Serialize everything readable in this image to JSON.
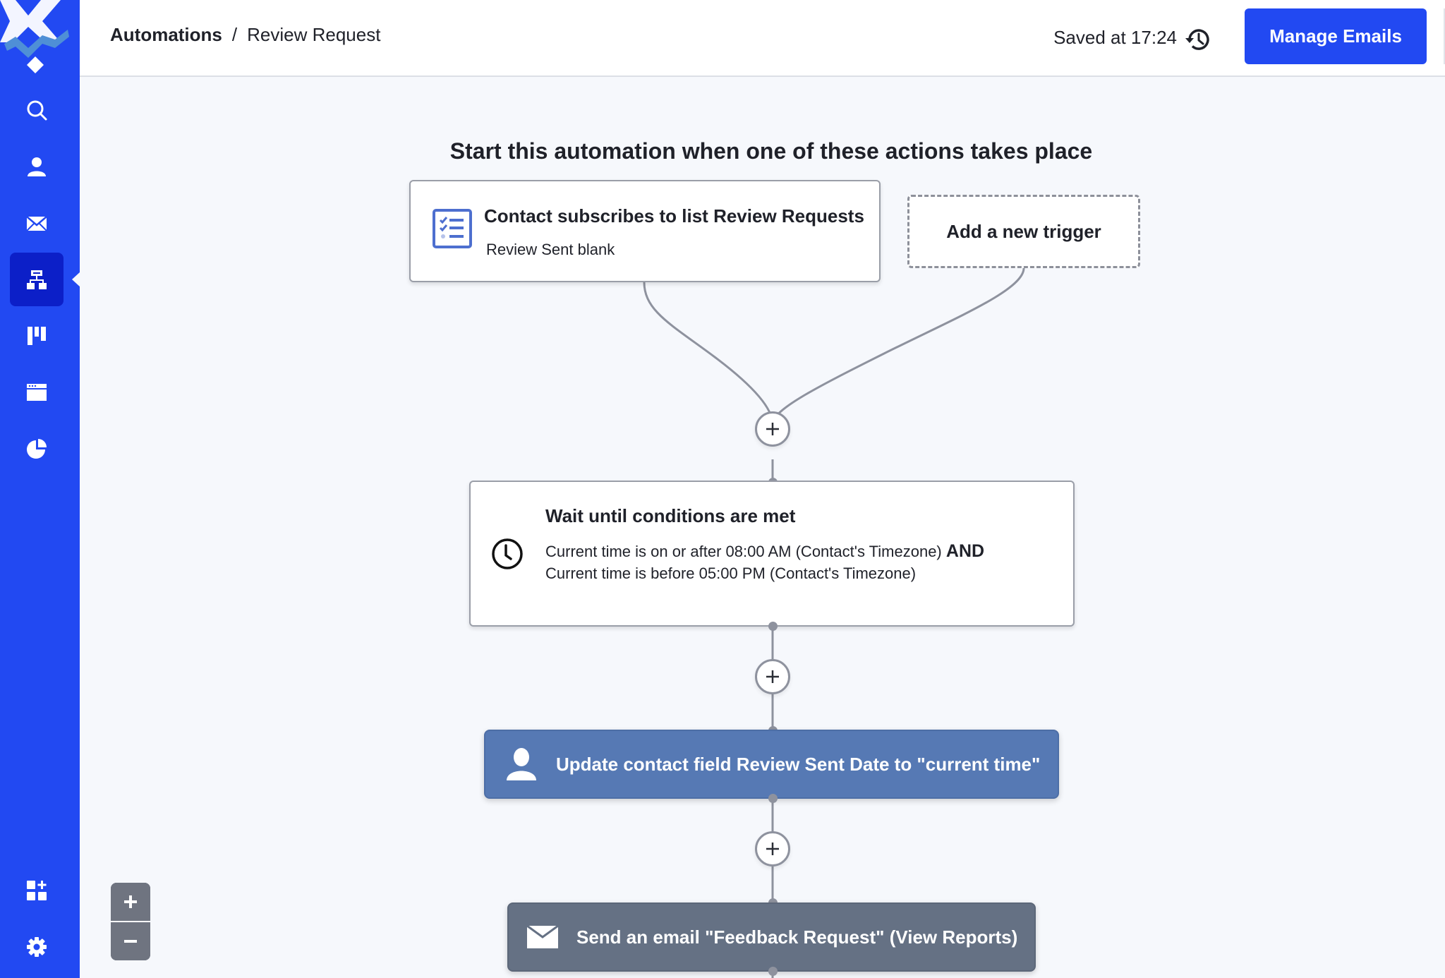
{
  "app": {
    "brand_color": "#2249f2",
    "active_nav_color": "#0c1fc8"
  },
  "sidebar": {
    "items": [
      {
        "id": "search",
        "icon": "search-icon",
        "label": "Search",
        "active": false
      },
      {
        "id": "contacts",
        "icon": "person-icon",
        "label": "Contacts",
        "active": false
      },
      {
        "id": "campaigns",
        "icon": "envelope-icon",
        "label": "Campaigns",
        "active": false
      },
      {
        "id": "automations",
        "icon": "org-chart-icon",
        "label": "Automations",
        "active": true
      },
      {
        "id": "deals",
        "icon": "pipeline-icon",
        "label": "Deals",
        "active": false
      },
      {
        "id": "website",
        "icon": "browser-window-icon",
        "label": "Website",
        "active": false
      },
      {
        "id": "reports",
        "icon": "pie-chart-icon",
        "label": "Reports",
        "active": false
      }
    ],
    "bottom_items": [
      {
        "id": "apps",
        "icon": "apps-add-icon",
        "label": "Apps"
      },
      {
        "id": "settings",
        "icon": "gear-icon",
        "label": "Settings"
      }
    ]
  },
  "header": {
    "breadcrumb": {
      "root": "Automations",
      "separator": "/",
      "current": "Review Request"
    },
    "saved_status": "Saved at 17:24",
    "history_icon": "history-icon",
    "manage_button": "Manage Emails"
  },
  "canvas": {
    "title": "Start this automation when one of these actions takes place",
    "triggers": [
      {
        "icon": "checklist-icon",
        "title": "Contact subscribes to list Review Requests",
        "subtitle": "Review Sent blank"
      }
    ],
    "add_trigger_label": "Add a new trigger",
    "steps": [
      {
        "type": "wait",
        "icon": "clock-icon",
        "title": "Wait until conditions are met",
        "condition_1": "Current time is on or after 08:00 AM (Contact's Timezone)",
        "conjunction": "AND",
        "condition_2": "Current time is before 05:00 PM (Contact's Timezone)"
      },
      {
        "type": "update_contact",
        "icon": "person-icon",
        "label": "Update contact field Review Sent Date to \"current time\"",
        "color": "#5679b4"
      },
      {
        "type": "send_email",
        "icon": "envelope-icon",
        "label": "Send an email \"Feedback Request\" (View Reports)",
        "color": "#657184"
      }
    ],
    "add_step_icon": "plus-icon"
  },
  "zoom_controls": {
    "zoom_in_icon": "plus-icon",
    "zoom_out_icon": "minus-icon"
  }
}
